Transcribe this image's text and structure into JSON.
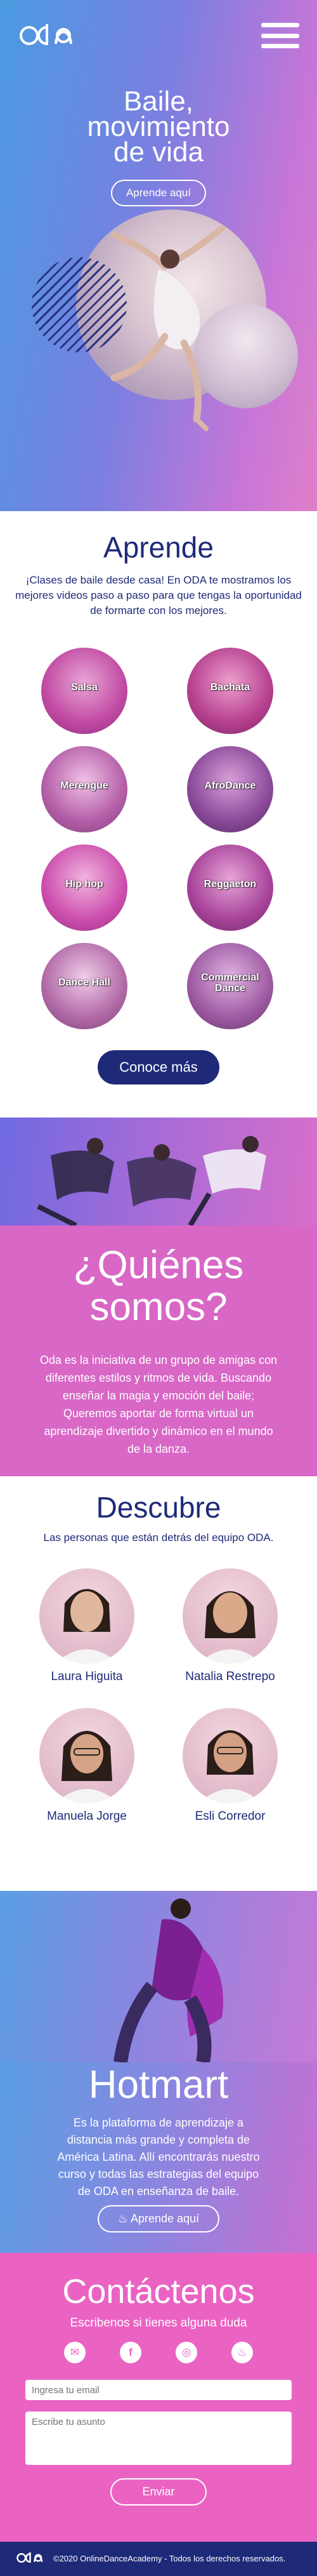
{
  "header": {
    "logo_alt": "oda logo"
  },
  "hero": {
    "title_lines": [
      "Baile,",
      "movimiento",
      "de vida"
    ],
    "button_label": "Aprende aquí"
  },
  "aprende": {
    "title": "Aprende",
    "intro": "¡Clases de baile desde casa! En ODA te mostramos los mejores videos paso a paso para que tengas la oportunidad de formarte con los mejores.",
    "dances": [
      {
        "label": "Salsa",
        "color": "#c14aa3"
      },
      {
        "label": "Bachata",
        "color": "#b6408f"
      },
      {
        "label": "Merengue",
        "color": "#b45ea8"
      },
      {
        "label": "AfroDance",
        "color": "#8b4a9a"
      },
      {
        "label": "Hip hop",
        "color": "#cc4fae"
      },
      {
        "label": "Reggaeton",
        "color": "#a8439a"
      },
      {
        "label": "Dance Hall",
        "color": "#b26aa7"
      },
      {
        "label": "Commercial Dance",
        "color": "#9e5aa2"
      }
    ],
    "button_label": "Conoce más"
  },
  "quienes": {
    "title_lines": [
      "¿Quiénes",
      "somos?"
    ],
    "body": "Oda es la iniciativa de un grupo de amigas con diferentes estilos y ritmos de vida. Buscando enseñar la magia y emoción del baile; Queremos aportar de forma virtual un aprendizaje divertido y dinámico en el mundo de la danza."
  },
  "descubre": {
    "title": "Descubre",
    "subtitle": "Las personas que están detrás del equipo ODA.",
    "members": [
      {
        "name": "Laura Higuita"
      },
      {
        "name": "Natalia Restrepo"
      },
      {
        "name": "Manuela Jorge"
      },
      {
        "name": "Esli Corredor"
      }
    ]
  },
  "hotmart": {
    "title": "Hotmart",
    "body": "Es la plataforma de aprendizaje a distancia más grande y completa de América Latina. Allí encontrarás nuestro curso y todas las estrategias del equipo de ODA en enseñanza de baile.",
    "button_label": "Aprende aquí"
  },
  "contact": {
    "title": "Contáctenos",
    "subtitle": "Escribenos si tienes alguna duda",
    "socials": [
      {
        "name": "email-icon",
        "glyph": "✉"
      },
      {
        "name": "facebook-icon",
        "glyph": "f"
      },
      {
        "name": "instagram-icon",
        "glyph": "◎"
      },
      {
        "name": "hotmart-icon",
        "glyph": "♨"
      }
    ],
    "email_placeholder": "Ingresa tu email",
    "subject_placeholder": "Escribe tu asunto",
    "button_label": "Enviar"
  },
  "footer": {
    "copyright": "©2020 OnlineDanceAcademy - Todos los derechos reservados."
  },
  "colors": {
    "navy": "#1e2a78",
    "pink": "#d867c6",
    "contact_pink": "#ea63c3",
    "blue": "#4a9ae0"
  }
}
